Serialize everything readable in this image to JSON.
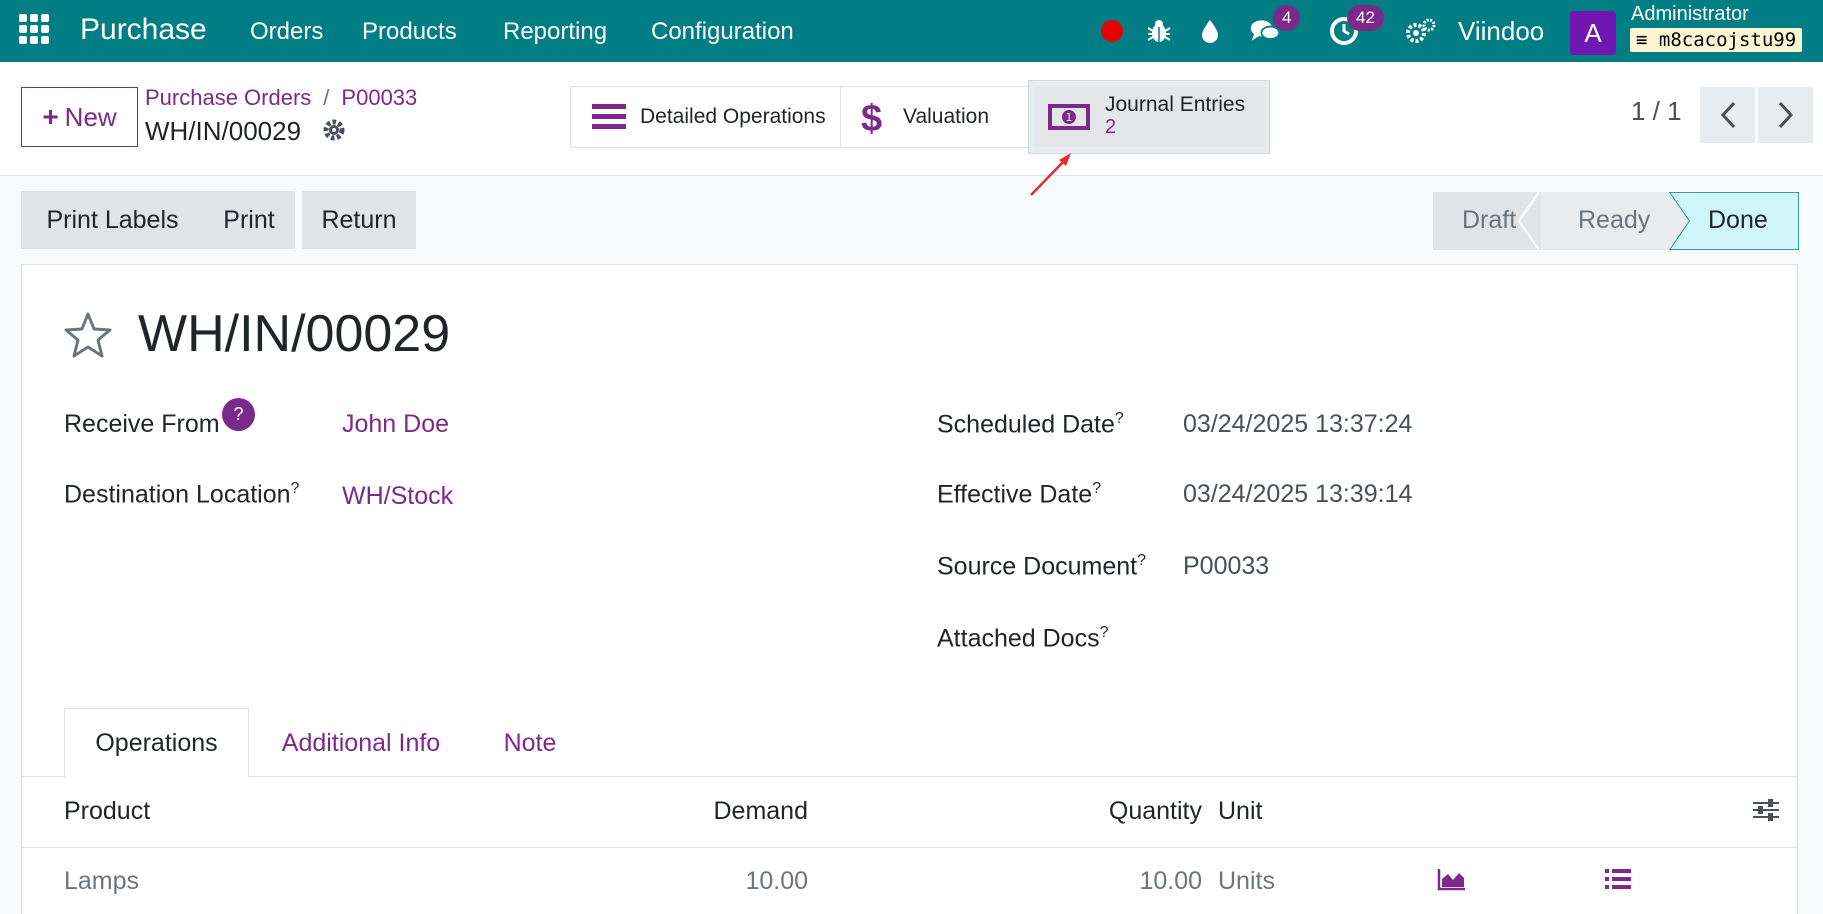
{
  "navbar": {
    "app_name": "Purchase",
    "menu": [
      "Orders",
      "Products",
      "Reporting",
      "Configuration"
    ],
    "messages_count": "4",
    "activities_count": "42",
    "company": "Viindoo",
    "avatar_letter": "A",
    "user_name": "Administrator",
    "database": "m8cacojstu99"
  },
  "control": {
    "new_label": "New",
    "breadcrumb": [
      "Purchase Orders",
      "P00033"
    ],
    "breadcrumb_sep": "/",
    "current_record": "WH/IN/00029",
    "smart_buttons": {
      "detailed_label": "Detailed Operations",
      "valuation_label": "Valuation",
      "journal_label": "Journal Entries",
      "journal_count": "2"
    },
    "pager": "1 / 1"
  },
  "actions": {
    "print_labels": "Print Labels",
    "print": "Print",
    "return": "Return"
  },
  "status": {
    "steps": [
      "Draft",
      "Ready",
      "Done"
    ],
    "current": "Done"
  },
  "form": {
    "title": "WH/IN/00029",
    "receive_from_label": "Receive From",
    "receive_from_value": "John Doe",
    "destination_label": "Destination Location",
    "destination_value": "WH/Stock",
    "scheduled_label": "Scheduled Date",
    "scheduled_value": "03/24/2025 13:37:24",
    "effective_label": "Effective Date",
    "effective_value": "03/24/2025 13:39:14",
    "source_label": "Source Document",
    "source_value": "P00033",
    "attached_label": "Attached Docs",
    "help_mark": "?"
  },
  "tabs": [
    "Operations",
    "Additional Info",
    "Note"
  ],
  "table": {
    "headers": [
      "Product",
      "Demand",
      "Quantity",
      "Unit"
    ],
    "rows": [
      {
        "product": "Lamps",
        "demand": "10.00",
        "quantity": "10.00",
        "unit": "Units"
      }
    ]
  },
  "colors": {
    "navbar": "#017e84",
    "accent": "#7c2a8a",
    "status_done": "#cff7fb"
  }
}
